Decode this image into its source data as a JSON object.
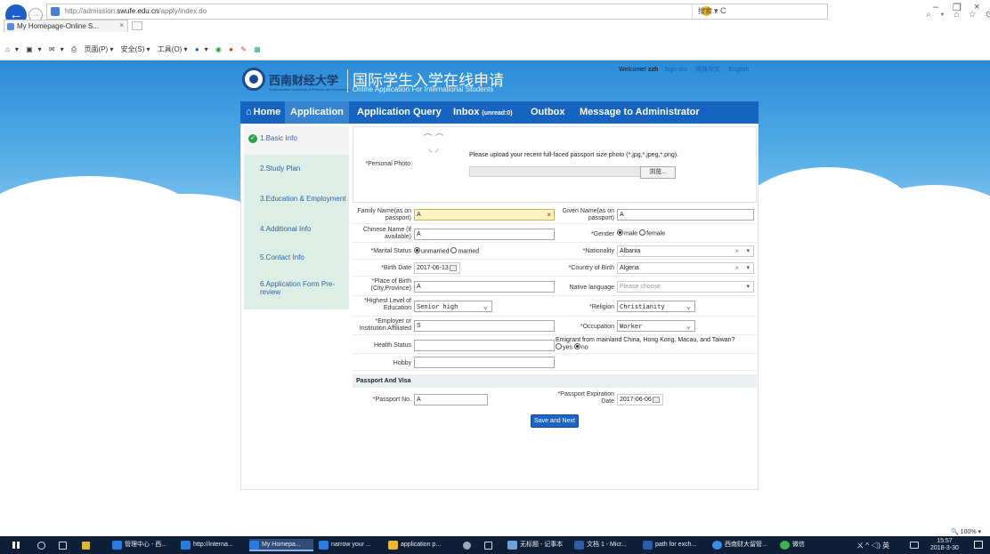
{
  "browser": {
    "url_prefix": "http://admission.",
    "url_domain": "swufe.edu.cn",
    "url_suffix": "/apply/index.do",
    "url_controls": "▾ C",
    "search_placeholder": "搜索...",
    "tab_title": "My Homepage-Online S...",
    "tab_close": "×",
    "cmd_items": [
      "▾",
      "▾",
      "▾",
      "页面(P) ▾",
      "安全(S) ▾",
      "工具(O) ▾",
      "▾"
    ],
    "toolbar_right": "⌕ ▾  ⌂ ☆ ⚙"
  },
  "header": {
    "logo_cn": "西南财经大学",
    "logo_en": "Southwestern University of Finance and Economics",
    "title_cn": "国际学生入学在线申请",
    "title_en": "Online Application For International Students",
    "welcome": "Welcome!",
    "username": "zzh",
    "sign_out": "Sign out",
    "lang_cn": "·简体中文",
    "lang_en": "·English"
  },
  "nav": {
    "home": "Home",
    "application": "Application",
    "query": "Application Query",
    "inbox": "Inbox",
    "inbox_unread": "(unread:0)",
    "outbox": "Outbox",
    "message": "Message to Administrator"
  },
  "sidebar": {
    "items": [
      {
        "label": "1.Basic Info"
      },
      {
        "label": "2.Study Plan"
      },
      {
        "label": "3.Education & Employment"
      },
      {
        "label": "4.Additional Info"
      },
      {
        "label": "5.Contact Info"
      },
      {
        "label": "6.Application Form Pre-review"
      }
    ]
  },
  "form": {
    "photo": {
      "label": "Personal Photo",
      "note": "Please upload your recent full-faced passport size photo (*.jpg,*.jpeg,*.png).",
      "browse": "浏览..."
    },
    "family_name": {
      "label": "Family Name(as on passport)",
      "value": "A",
      "error_icon": "×"
    },
    "given_name": {
      "label": "Given Name(as on passport)",
      "value": "A"
    },
    "chinese_name": {
      "label": "Chinese Name (if available)",
      "value": "A"
    },
    "gender": {
      "label": "Gender",
      "options": [
        "male",
        "female"
      ],
      "selected": "male"
    },
    "marital": {
      "label": "Marital Status",
      "options": [
        "unmarried",
        "married"
      ],
      "selected": "unmarried"
    },
    "nationality": {
      "label": "Nationality",
      "value": "Albania"
    },
    "birth_date": {
      "label": "Birth Date",
      "value": "2017-06-13"
    },
    "country_birth": {
      "label": "Country of Birth",
      "value": "Algeria"
    },
    "place_birth": {
      "label": "Place of Birth (City,Province)",
      "value": "A"
    },
    "native_language": {
      "label": "Native language",
      "placeholder": "Please choose"
    },
    "education": {
      "label": "Highest Level of Education",
      "value": "Senior high"
    },
    "religion": {
      "label": "Religion",
      "value": "Christianity"
    },
    "employer": {
      "label": "Employer or Institution Affiliated",
      "value": "S"
    },
    "occupation": {
      "label": "Occupation",
      "value": "Worker"
    },
    "health": {
      "label": "Health Status",
      "value": ""
    },
    "emigrant": {
      "question": "Emigrant from mainland China, Hong Kong, Macau, and Taiwan?",
      "options": [
        "yes",
        "no"
      ],
      "selected": "no"
    },
    "hobby": {
      "label": "Hobby",
      "value": ""
    },
    "passport_section": "Passport And Visa",
    "passport_no": {
      "label": "Passport No.",
      "value": "A"
    },
    "passport_exp": {
      "label": "Passport Expiration Date",
      "value": "2017-06-06"
    },
    "save_next": "Save and Next"
  },
  "status": {
    "zoom": "100%"
  },
  "taskbar": {
    "apps": [
      {
        "label": "管理中心 - 西..."
      },
      {
        "label": "http://interna..."
      },
      {
        "label": "My Homepa..."
      },
      {
        "label": "narrow your ..."
      },
      {
        "label": "application p..."
      },
      {
        "label": "无标题 - 记事本"
      },
      {
        "label": "文档 1 - Micr..."
      },
      {
        "label": "path for exch..."
      },
      {
        "label": "西南财大留管..."
      },
      {
        "label": "微信"
      }
    ],
    "tray": "ㄨ  ^ ◁) 英",
    "time": "15:57",
    "date": "2018-3-30"
  }
}
